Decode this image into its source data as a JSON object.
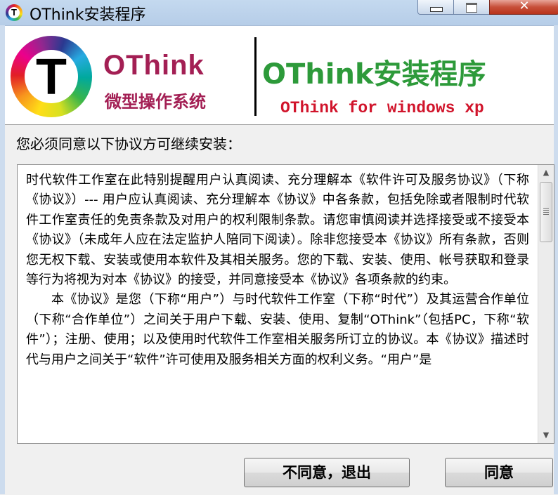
{
  "window": {
    "title": "OThink安装程序",
    "close_glyph": "✕"
  },
  "banner": {
    "logo_letter": "T",
    "brand_name": "OThink",
    "brand_subtitle": "微型操作系统",
    "headline": "OThink安装程序",
    "tagline": "OThink for windows xp"
  },
  "prompt": "您必须同意以下协议方可继续安装：",
  "license": {
    "paragraphs": [
      "时代软件工作室在此特别提醒用户认真阅读、充分理解本《软件许可及服务协议》（下称《协议》）--- 用户应认真阅读、充分理解本《协议》中各条款，包括免除或者限制时代软件工作室责任的免责条款及对用户的权利限制条款。请您审慎阅读并选择接受或不接受本《协议》（未成年人应在法定监护人陪同下阅读）。除非您接受本《协议》所有条款，否则您无权下载、安装或使用本软件及其相关服务。您的下载、安装、使用、帐号获取和登录等行为将视为对本《协议》的接受，并同意接受本《协议》各项条款的约束。",
      "本《协议》是您（下称“用户”）与时代软件工作室（下称“时代”）及其运营合作单位（下称“合作单位”）之间关于用户下载、安装、使用、复制“OThink”（包括PC，下称“软件”）；注册、使用；以及使用时代软件工作室相关服务所订立的协议。本《协议》描述时代与用户之间关于“软件”许可使用及服务相关方面的权利义务。“用户”是"
    ]
  },
  "scrollbar": {
    "up_glyph": "▲",
    "down_glyph": "▼"
  },
  "buttons": {
    "disagree": "不同意，退出",
    "agree": "同意"
  }
}
